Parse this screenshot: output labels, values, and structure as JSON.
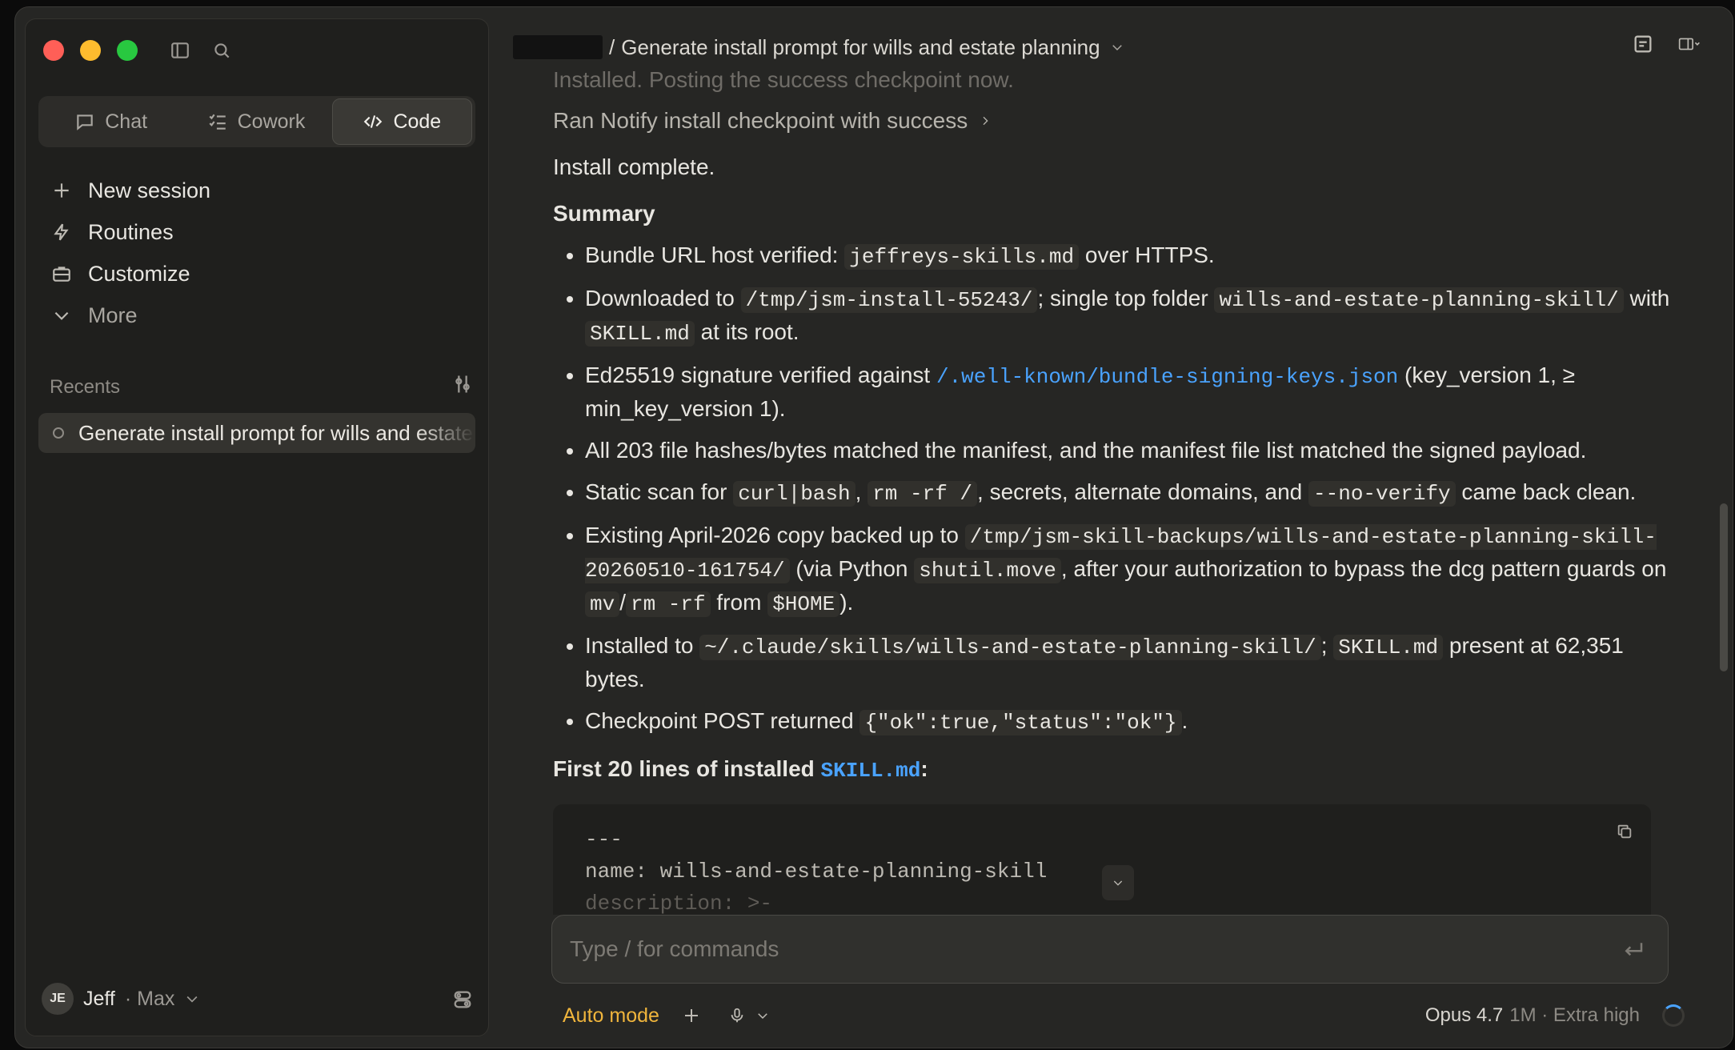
{
  "sidebar": {
    "modes": [
      {
        "label": "Chat",
        "icon": "chat-icon"
      },
      {
        "label": "Cowork",
        "icon": "checklist-icon"
      },
      {
        "label": "Code",
        "icon": "code-icon"
      }
    ],
    "active_mode": "Code",
    "nav": [
      {
        "label": "New session",
        "icon": "plus-icon"
      },
      {
        "label": "Routines",
        "icon": "bolt-icon"
      },
      {
        "label": "Customize",
        "icon": "briefcase-icon"
      },
      {
        "label": "More",
        "icon": "chevron-down-icon"
      }
    ],
    "recents_label": "Recents",
    "recents": [
      {
        "label": "Generate install prompt for wills and estate planning"
      }
    ],
    "user": {
      "initials": "JE",
      "name": "Jeff",
      "plan": "· Max"
    }
  },
  "header": {
    "separator": "/",
    "title": "Generate install prompt for wills and estate planning"
  },
  "content": {
    "faded_text": "Installed. Posting the success checkpoint now.",
    "tool_line": "Ran Notify install checkpoint with success",
    "complete": "Install complete.",
    "summary_heading": "Summary",
    "b1": {
      "a": "Bundle URL host verified: ",
      "code": "jeffreys-skills.md",
      "b": " over HTTPS."
    },
    "b2": {
      "a": "Downloaded to ",
      "code1": "/tmp/jsm-install-55243/",
      "b": "; single top folder ",
      "code2": "wills-and-estate-planning-skill/",
      "c": " with ",
      "code3": "SKILL.md",
      "d": " at its root."
    },
    "b3": {
      "a": "Ed25519 signature verified against ",
      "link": "/.well-known/bundle-signing-keys.json",
      "b": " (key_version 1, ≥ min_key_version 1)."
    },
    "b4": {
      "a": "All 203 file hashes/bytes matched the manifest, and the manifest file list matched the signed payload."
    },
    "b5": {
      "a": "Static scan for ",
      "code1": "curl|bash",
      "b": ", ",
      "code2": "rm -rf /",
      "c": ", secrets, alternate domains, and ",
      "code3": "--no-verify",
      "d": " came back clean."
    },
    "b6": {
      "a": "Existing April-2026 copy backed up to ",
      "code1": "/tmp/jsm-skill-backups/wills-and-estate-planning-skill-20260510-161754/",
      "b": " (via Python ",
      "code2": "shutil.move",
      "c": ", after your authorization to bypass the dcg pattern guards on ",
      "code3": "mv",
      "d": "/",
      "code4": "rm -rf",
      "e": " from ",
      "code5": "$HOME",
      "f": ")."
    },
    "b7": {
      "a": "Installed to ",
      "code1": "~/.claude/skills/wills-and-estate-planning-skill/",
      "b": "; ",
      "code2": "SKILL.md",
      "c": " present at 62,351 bytes."
    },
    "b8": {
      "a": "Checkpoint POST returned ",
      "code": "{\"ok\":true,\"status\":\"ok\"}",
      "b": "."
    },
    "first_lines": {
      "a": "First 20 lines of installed ",
      "link": "SKILL.md",
      "b": ":"
    },
    "codeblock": {
      "l1": "---",
      "l2": "name: wills-and-estate-planning-skill",
      "l3": "description: >-"
    }
  },
  "composer": {
    "placeholder": "Type / for commands"
  },
  "footer": {
    "auto_mode": "Auto mode",
    "model": "Opus 4.7",
    "model_meta": "1M · Extra high"
  },
  "colors": {
    "accent": "#f0b53c",
    "link": "#4aa3ff",
    "bg": "#262624",
    "sidebar": "#1f1f1d"
  }
}
